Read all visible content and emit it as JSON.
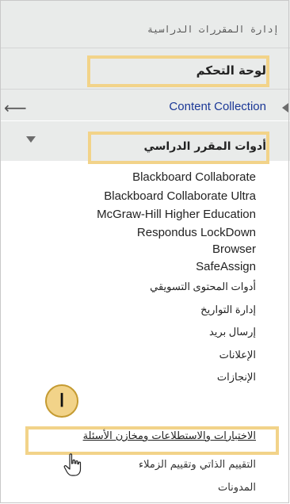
{
  "panel": {
    "title": "إدارة المقررات الدراسية",
    "control_panel_label": "لوحة التحكم",
    "content_collection_label": "Content Collection",
    "course_tools_label": "أدوات المقرر الدراسي"
  },
  "tools": [
    "Blackboard Collaborate",
    "Blackboard Collaborate Ultra",
    "McGraw-Hill Higher Education",
    "Respondus LockDown",
    "Browser",
    "SafeAssign",
    "أدوات المحتوى التسويقي",
    "إدارة التواريخ",
    "إرسال بريد",
    "الإعلانات",
    "الإنجازات"
  ],
  "quiz_link": "الاختبارات والاستطلاعات ومخازن الأسئلة",
  "peer_assessment_link": "التقييم الذاتي وتقييم الزملاء",
  "blogs_link": "المدونات",
  "step_badge": "ا",
  "colors": {
    "highlight": "#f2d389",
    "link_blue": "#1a3796",
    "panel_gray": "#e9ebea"
  },
  "icons": {
    "back": "arrow-left-icon",
    "expand": "chevron-down-icon",
    "cursor": "hand-pointer-icon"
  }
}
